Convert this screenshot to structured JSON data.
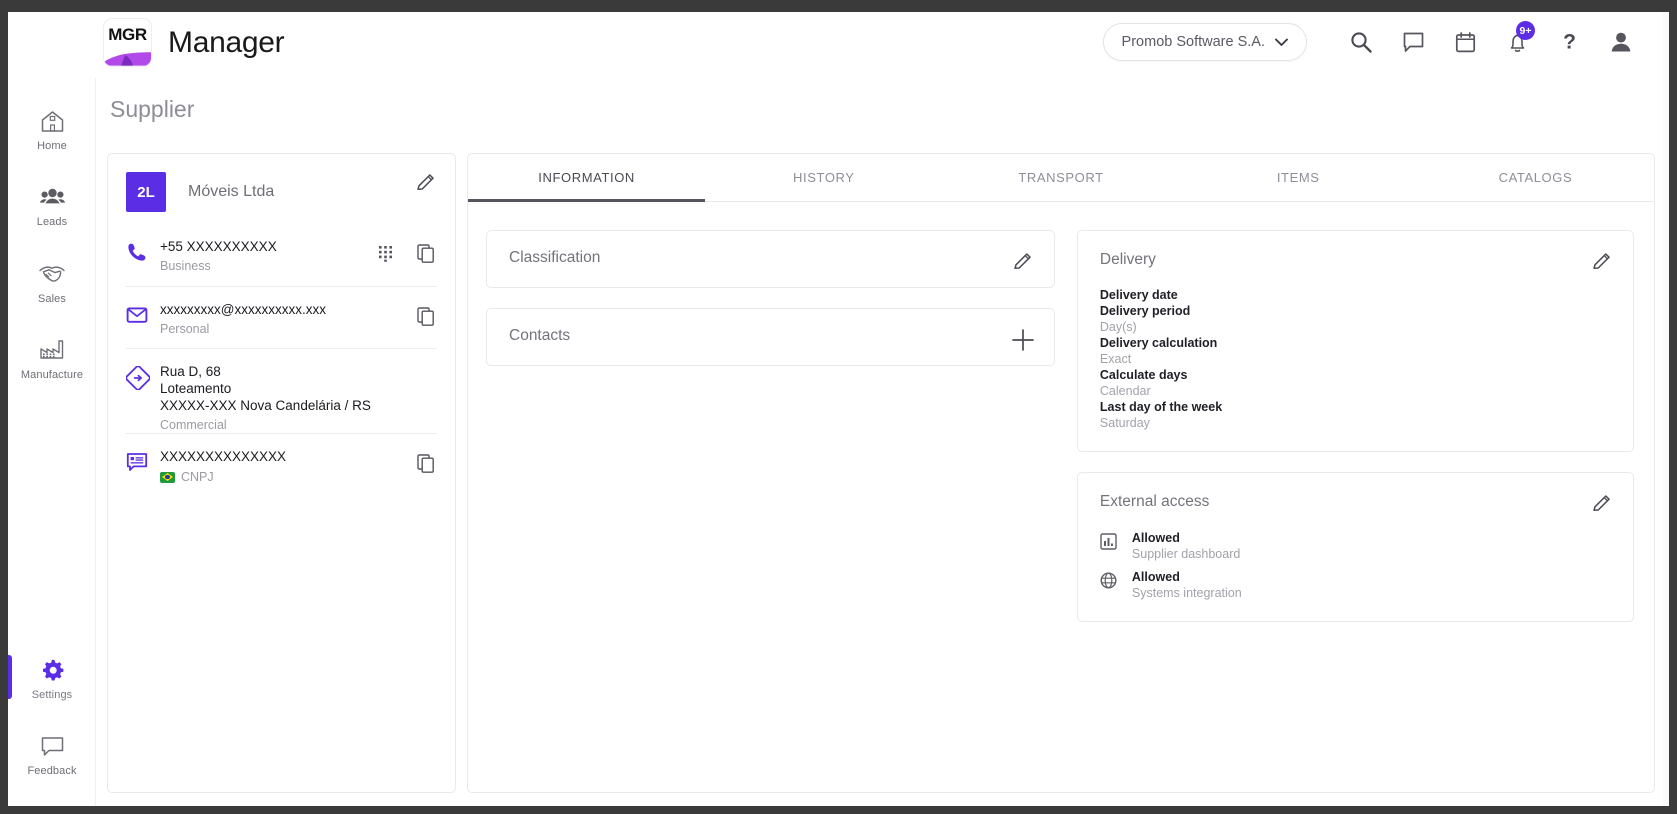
{
  "header": {
    "logo_text": "MGR",
    "app_title": "Manager",
    "org_selector": "Promob Software S.A.",
    "icons": {
      "search": "search-icon",
      "chat": "chat-icon",
      "calendar": "calendar-icon",
      "notifications": "bell-icon",
      "help": "help-icon",
      "profile": "profile-icon"
    },
    "notification_badge": "9+"
  },
  "sidebar": {
    "items": [
      {
        "label": "Home",
        "icon": "home-icon",
        "active": false
      },
      {
        "label": "Leads",
        "icon": "people-icon",
        "active": false
      },
      {
        "label": "Sales",
        "icon": "handshake-icon",
        "active": false
      },
      {
        "label": "Manufacture",
        "icon": "factory-icon",
        "active": false
      }
    ],
    "bottom_items": [
      {
        "label": "Settings",
        "icon": "gear-icon",
        "active": true
      },
      {
        "label": "Feedback",
        "icon": "speech-bubble-icon",
        "active": false
      }
    ]
  },
  "page": {
    "title": "Supplier"
  },
  "supplier_card": {
    "avatar_initials": "2L",
    "company_name": "Móveis Ltda",
    "edit_label": "pencil-icon",
    "rows": [
      {
        "icon": "phone-icon",
        "main": "+55 XXXXXXXXXX",
        "sub": "Business",
        "actions": [
          "dialpad-icon",
          "copy-icon"
        ]
      },
      {
        "icon": "email-icon",
        "main": "xxxxxxxxx@xxxxxxxxxx.xxx",
        "sub": "Personal",
        "actions": [
          "copy-icon"
        ]
      },
      {
        "icon": "address-icon",
        "main_lines": [
          "Rua D, 68",
          "Loteamento",
          "XXXXX-XXX Nova Candelária / RS"
        ],
        "sub": "Commercial",
        "actions": []
      },
      {
        "icon": "document-icon",
        "main": "XXXXXXXXXXXXXX",
        "sub": "CNPJ",
        "flag": "brazil-flag",
        "actions": [
          "copy-icon"
        ]
      }
    ]
  },
  "tabs": [
    {
      "label": "INFORMATION",
      "active": true
    },
    {
      "label": "HISTORY",
      "active": false
    },
    {
      "label": "TRANSPORT",
      "active": false
    },
    {
      "label": "ITEMS",
      "active": false
    },
    {
      "label": "CATALOGS",
      "active": false
    }
  ],
  "cards": {
    "classification": {
      "title": "Classification",
      "action": "pencil-icon"
    },
    "contacts": {
      "title": "Contacts",
      "action": "plus-icon"
    },
    "delivery": {
      "title": "Delivery",
      "action": "pencil-icon",
      "entries": [
        {
          "label": "Delivery date",
          "value": null
        },
        {
          "label": "Delivery period",
          "value": "Day(s)"
        },
        {
          "label": "Delivery calculation",
          "value": "Exact"
        },
        {
          "label": "Calculate days",
          "value": "Calendar"
        },
        {
          "label": "Last day of the week",
          "value": "Saturday"
        }
      ]
    },
    "external_access": {
      "title": "External access",
      "action": "pencil-icon",
      "entries": [
        {
          "icon": "chart-icon",
          "status": "Allowed",
          "name": "Supplier dashboard"
        },
        {
          "icon": "globe-icon",
          "status": "Allowed",
          "name": "Systems integration"
        }
      ]
    }
  },
  "colors": {
    "accent": "#5b2ee5",
    "text_dark": "#1f1f26",
    "text_muted": "#a2a2aa",
    "border": "#e9e9ec"
  }
}
